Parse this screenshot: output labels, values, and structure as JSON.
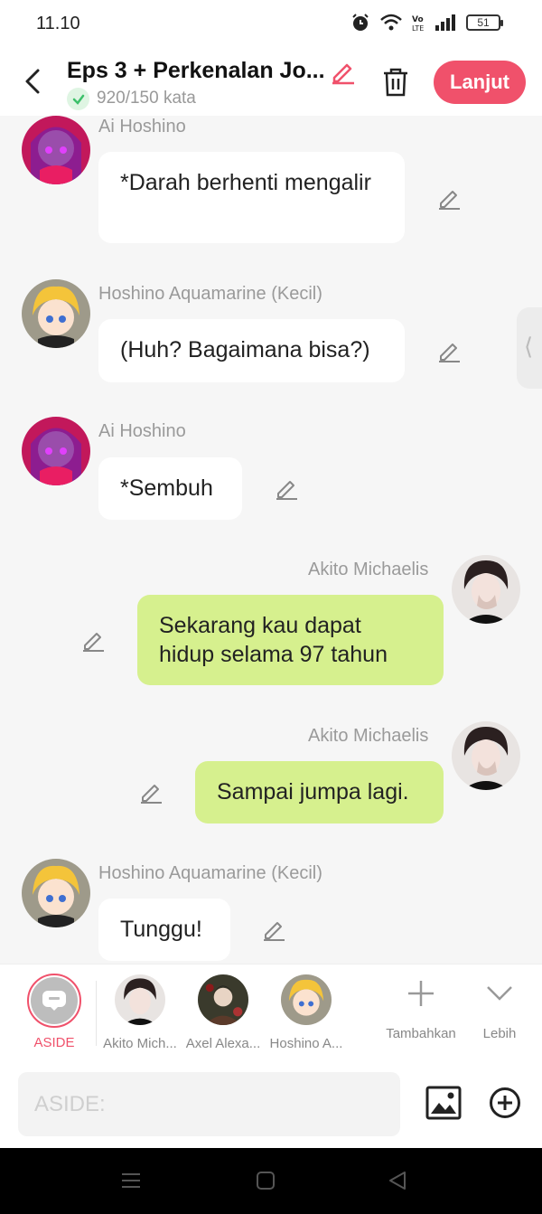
{
  "status": {
    "time": "11.10",
    "battery": "51"
  },
  "header": {
    "title": "Eps 3 + Perkenalan Jo...",
    "wordcount": "920/150 kata",
    "next_label": "Lanjut"
  },
  "messages": [
    {
      "side": "left",
      "name": "Ai Hoshino",
      "text": "*Darah berhenti mengalir",
      "avatar": "ai"
    },
    {
      "side": "left",
      "name": "Hoshino Aquamarine (Kecil)",
      "text": "(Huh? Bagaimana bisa?)",
      "avatar": "aqua"
    },
    {
      "side": "left",
      "name": "Ai Hoshino",
      "text": "*Sembuh",
      "avatar": "ai"
    },
    {
      "side": "right",
      "name": "Akito Michaelis",
      "text": "Sekarang kau dapat hidup selama 97 tahun",
      "avatar": "akito"
    },
    {
      "side": "right",
      "name": "Akito Michaelis",
      "text": "Sampai jumpa lagi.",
      "avatar": "akito"
    },
    {
      "side": "left",
      "name": "Hoshino Aquamarine (Kecil)",
      "text": "Tunggu!",
      "avatar": "aqua"
    }
  ],
  "characters": {
    "aside": "ASIDE",
    "list": [
      "Akito Mich...",
      "Axel Alexa...",
      "Hoshino A..."
    ],
    "add": "Tambahkan",
    "more": "Lebih"
  },
  "input": {
    "placeholder": "ASIDE:"
  },
  "colors": {
    "accent": "#f0516b",
    "bubble_right": "#d6f08e",
    "bubble_left": "#ffffff",
    "check": "#3cc06a"
  },
  "icons": [
    "back-icon",
    "pencil-icon",
    "trash-icon",
    "check-icon",
    "plus-icon",
    "chevron-down-icon",
    "image-icon",
    "add-circle-icon"
  ]
}
